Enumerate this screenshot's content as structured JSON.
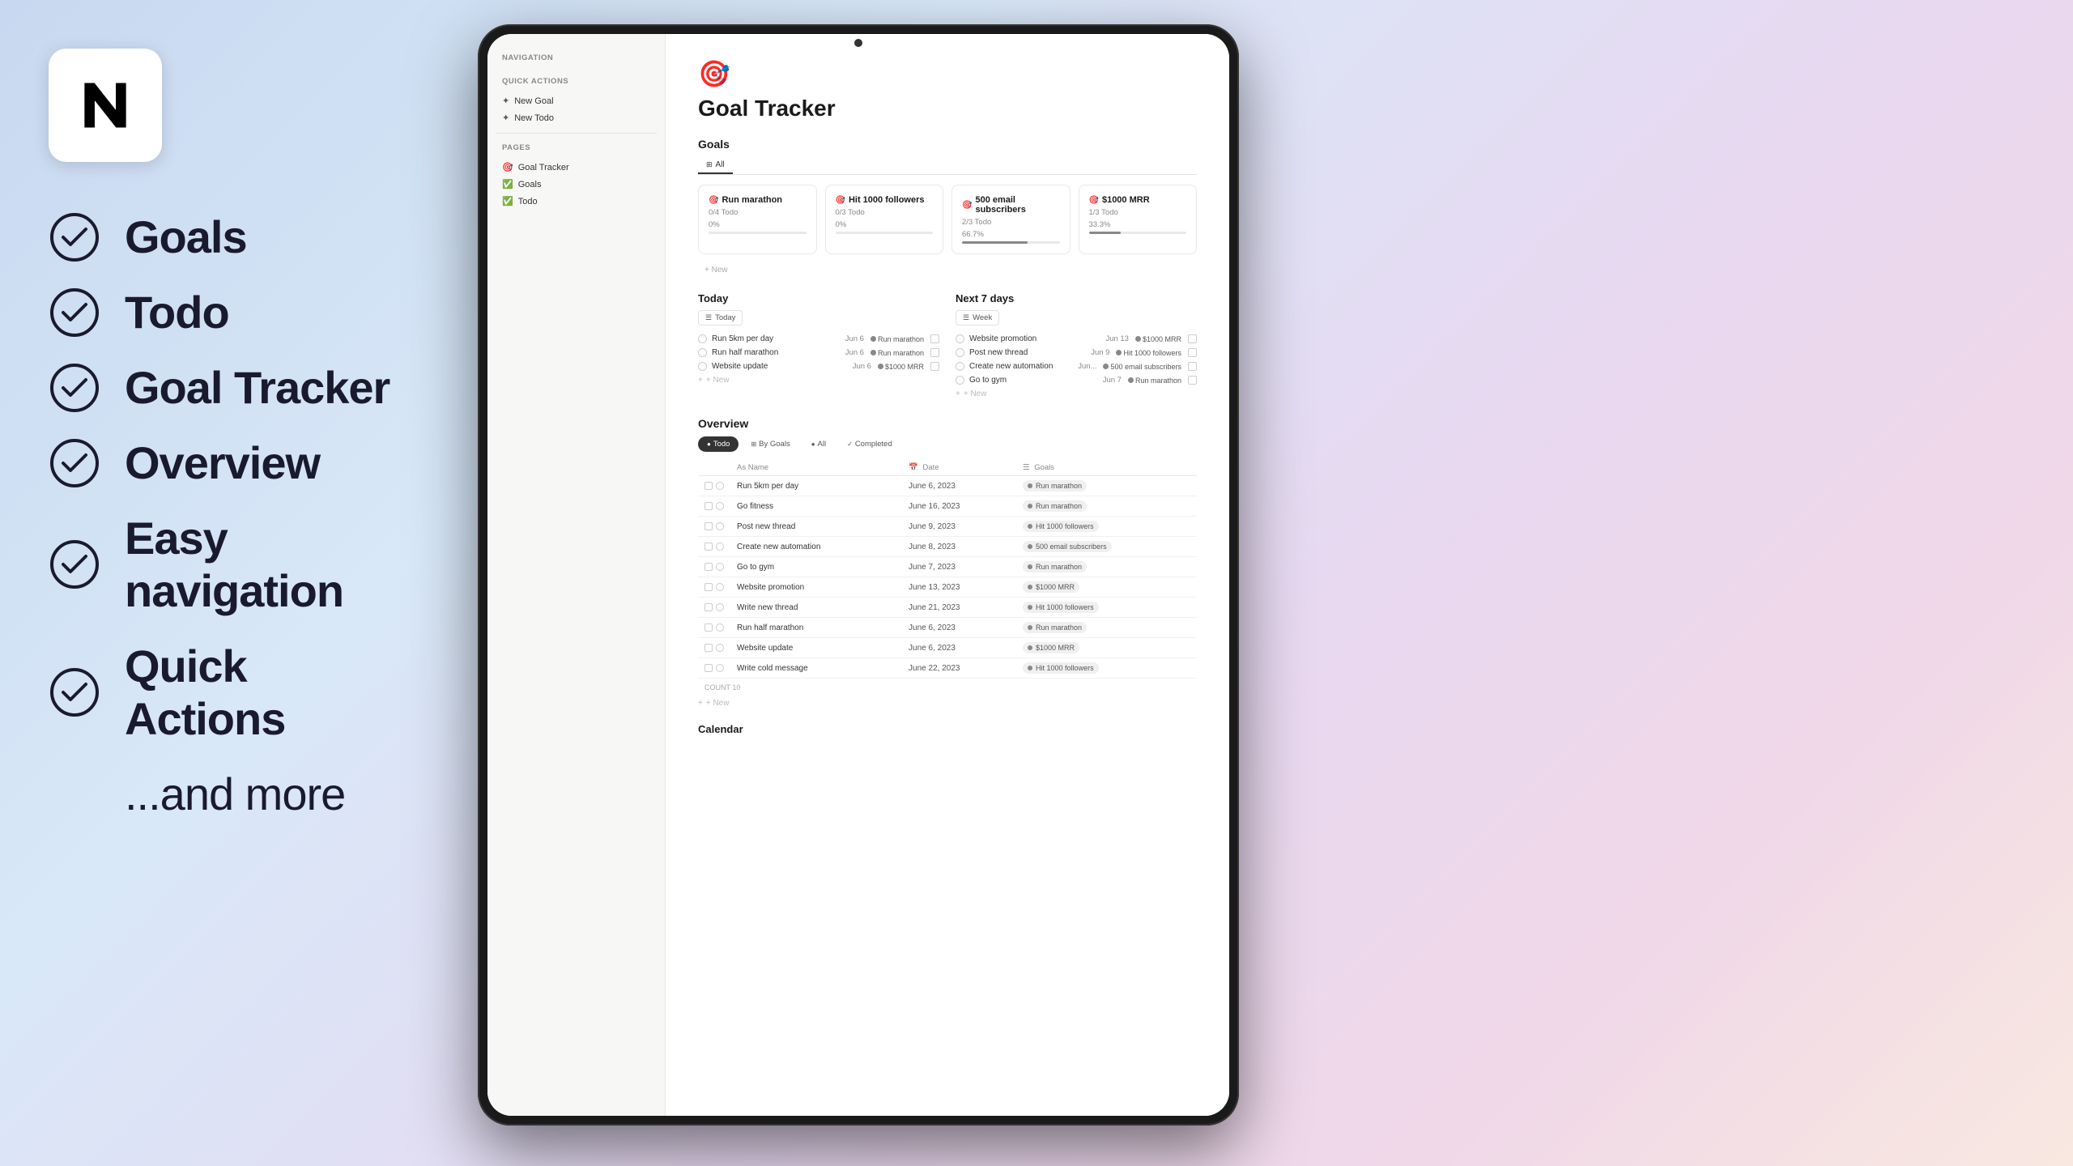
{
  "left": {
    "features": [
      {
        "id": "goals",
        "text": "Goals"
      },
      {
        "id": "todo",
        "text": "Todo"
      },
      {
        "id": "goal-tracker",
        "text": "Goal Tracker"
      },
      {
        "id": "overview",
        "text": "Overview"
      },
      {
        "id": "easy-nav",
        "text": "Easy navigation"
      },
      {
        "id": "quick-actions",
        "text": "Quick Actions"
      },
      {
        "id": "more",
        "text": "...and more"
      }
    ]
  },
  "sidebar": {
    "navigation_label": "Navigation",
    "quick_actions_label": "Quick Actions",
    "new_goal_label": "New Goal",
    "new_todo_label": "New Todo",
    "pages_label": "Pages",
    "pages": [
      {
        "icon": "🎯",
        "text": "Goal Tracker"
      },
      {
        "icon": "✅",
        "text": "Goals"
      },
      {
        "icon": "✅",
        "text": "Todo"
      }
    ]
  },
  "page": {
    "icon": "🎯",
    "title": "Goal Tracker"
  },
  "goals_section": {
    "title": "Goals",
    "view_tab": "All",
    "cards": [
      {
        "title": "Run marathon",
        "todo": "0/4 Todo",
        "progress_text": "0%",
        "progress": 0
      },
      {
        "title": "Hit 1000 followers",
        "todo": "0/3 Todo",
        "progress_text": "0%",
        "progress": 0
      },
      {
        "title": "500 email subscribers",
        "todo": "2/3 Todo",
        "progress_text": "66.7%",
        "progress": 67
      },
      {
        "title": "$1000 MRR",
        "todo": "1/3 Todo",
        "progress_text": "33.3%",
        "progress": 33
      }
    ],
    "add_new": "+ New"
  },
  "today_section": {
    "title": "Today",
    "view_label": "Today",
    "tasks": [
      {
        "name": "Run 5km per day",
        "date": "Jun 6",
        "goal": "Run marathon"
      },
      {
        "name": "Run half marathon",
        "date": "Jun 6",
        "goal": "Run marathon"
      },
      {
        "name": "Website update",
        "date": "Jun 6",
        "goal": "$1000 MRR"
      }
    ],
    "add_label": "+ New"
  },
  "next7_section": {
    "title": "Next 7 days",
    "view_label": "Week",
    "tasks": [
      {
        "name": "Website promotion",
        "date": "Jun 13",
        "goal": "$1000 MRR"
      },
      {
        "name": "Post new thread",
        "date": "Jun 9",
        "goal": "Hit 1000 followers"
      },
      {
        "name": "Create new automation",
        "date": "Jun...",
        "goal": "500 email subscribers"
      },
      {
        "name": "Go to gym",
        "date": "Jun 7",
        "goal": "Run marathon"
      }
    ],
    "add_label": "+ New"
  },
  "overview_section": {
    "title": "Overview",
    "tabs": [
      "Todo",
      "By Goals",
      "All",
      "Completed"
    ],
    "active_tab": "Todo",
    "columns": [
      "As Name",
      "Date",
      "Goals"
    ],
    "rows": [
      {
        "name": "Run 5km per day",
        "date": "June 6, 2023",
        "goal": "Run marathon"
      },
      {
        "name": "Go fitness",
        "date": "June 16, 2023",
        "goal": "Run marathon"
      },
      {
        "name": "Post new thread",
        "date": "June 9, 2023",
        "goal": "Hit 1000 followers"
      },
      {
        "name": "Create new automation",
        "date": "June 8, 2023",
        "goal": "500 email subscribers"
      },
      {
        "name": "Go to gym",
        "date": "June 7, 2023",
        "goal": "Run marathon"
      },
      {
        "name": "Website promotion",
        "date": "June 13, 2023",
        "goal": "$1000 MRR"
      },
      {
        "name": "Write new thread",
        "date": "June 21, 2023",
        "goal": "Hit 1000 followers"
      },
      {
        "name": "Run half marathon",
        "date": "June 6, 2023",
        "goal": "Run marathon"
      },
      {
        "name": "Website update",
        "date": "June 6, 2023",
        "goal": "$1000 MRR"
      },
      {
        "name": "Write cold message",
        "date": "June 22, 2023",
        "goal": "Hit 1000 followers"
      }
    ],
    "count_label": "COUNT  10",
    "add_label": "+ New"
  },
  "calendar_section": {
    "title": "Calendar"
  }
}
